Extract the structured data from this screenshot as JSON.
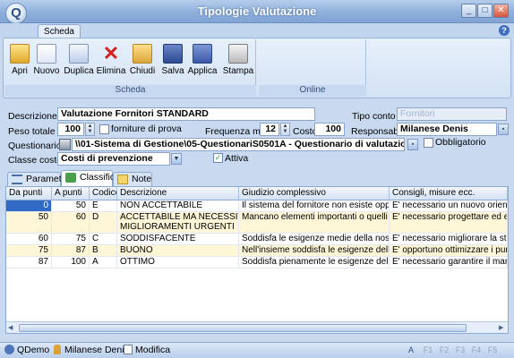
{
  "window": {
    "title": "Tipologie Valutazione",
    "logo_letter": "Q"
  },
  "ribbon": {
    "tab": "Scheda",
    "buttons": [
      {
        "label": "Apri",
        "icon": "open-folder-icon"
      },
      {
        "label": "Nuovo",
        "icon": "new-document-icon"
      },
      {
        "label": "Duplica",
        "icon": "duplicate-icon"
      },
      {
        "label": "Elimina",
        "icon": "delete-x-icon"
      },
      {
        "label": "Chiudi",
        "icon": "close-folder-icon"
      },
      {
        "label": "Salva",
        "icon": "save-disk-icon"
      },
      {
        "label": "Applica",
        "icon": "apply-icon"
      },
      {
        "label": "Stampa",
        "icon": "printer-icon"
      }
    ],
    "group_scheda": "Scheda",
    "group_online": "Online"
  },
  "form": {
    "descrizione_label": "Descrizione",
    "descrizione": "Valutazione Fornitori STANDARD",
    "tipo_conto_label": "Tipo conto",
    "tipo_conto": "Fornitori",
    "peso_totale_label": "Peso totale",
    "peso_totale": "100",
    "forniture_label": "forniture di prova",
    "frequenza_label": "Frequenza mesi",
    "frequenza": "12",
    "costo_label": "Costo",
    "costo": "100",
    "responsabile_label": "Responsabile",
    "responsabile": "Milanese Denis",
    "questionario_label": "Questionario",
    "questionario": "\\\\01-Sistema di Gestione\\05-QuestionariS0501A - Questionario di valutazione dei fornit",
    "obbligatorio_label": "Obbligatorio",
    "classe_costo_label": "Classe costo",
    "classe_costo": "Costi di prevenzione",
    "attiva_label": "Attiva",
    "attiva_mark": "✓"
  },
  "tabs": {
    "parametri": "Parametri",
    "classifica": "Classifica",
    "note": "Note"
  },
  "grid": {
    "columns": [
      "Da punti",
      "A punti",
      "Codice",
      "Descrizione",
      "Giudizio complessivo",
      "Consigli, misure ecc."
    ],
    "rows": [
      {
        "da": "0",
        "a": "50",
        "codice": "E",
        "descrizione": "NON ACCETTABILE",
        "giudizio": "Il sistema del fornitore non esiste oppure è carat",
        "consigli": "E' necessario un nuovo orientamento"
      },
      {
        "da": "50",
        "a": "60",
        "codice": "D",
        "descrizione": "ACCETTABILE MA NECESSITANO",
        "descrizione2": "MIGLIORAMENTI URGENTI",
        "giudizio": "Mancano elementi importanti o quelli che ci sono",
        "consigli": "E' necessario progettare ed eseguire"
      },
      {
        "da": "60",
        "a": "75",
        "codice": "C",
        "descrizione": "SODDISFACENTE",
        "giudizio": "Soddisfa le esigenze medie della nostra organizza",
        "consigli": "E' necessario migliorare la struttura de"
      },
      {
        "da": "75",
        "a": "87",
        "codice": "B",
        "descrizione": "BUONO",
        "giudizio": "Nell'insieme soddisfa le esigenze dell'organizzaz",
        "consigli": "E' opportuno ottimizzare i punti deboli"
      },
      {
        "da": "87",
        "a": "100",
        "codice": "A",
        "descrizione": "OTTIMO",
        "giudizio": "Soddisfa pienamente le esigenze dell'organizza",
        "consigli": "E' necessario garantire il mantenimen"
      }
    ]
  },
  "status": {
    "app": "QDemo",
    "user": "Milanese Denis",
    "mode": "Modifica",
    "keys": [
      "A",
      "F1",
      "F2",
      "F3",
      "F4",
      "F5"
    ]
  },
  "colors": {
    "accent": "#3f6ec0",
    "selected_row": "#316ac5",
    "highlight_row": "#fff6d8"
  }
}
